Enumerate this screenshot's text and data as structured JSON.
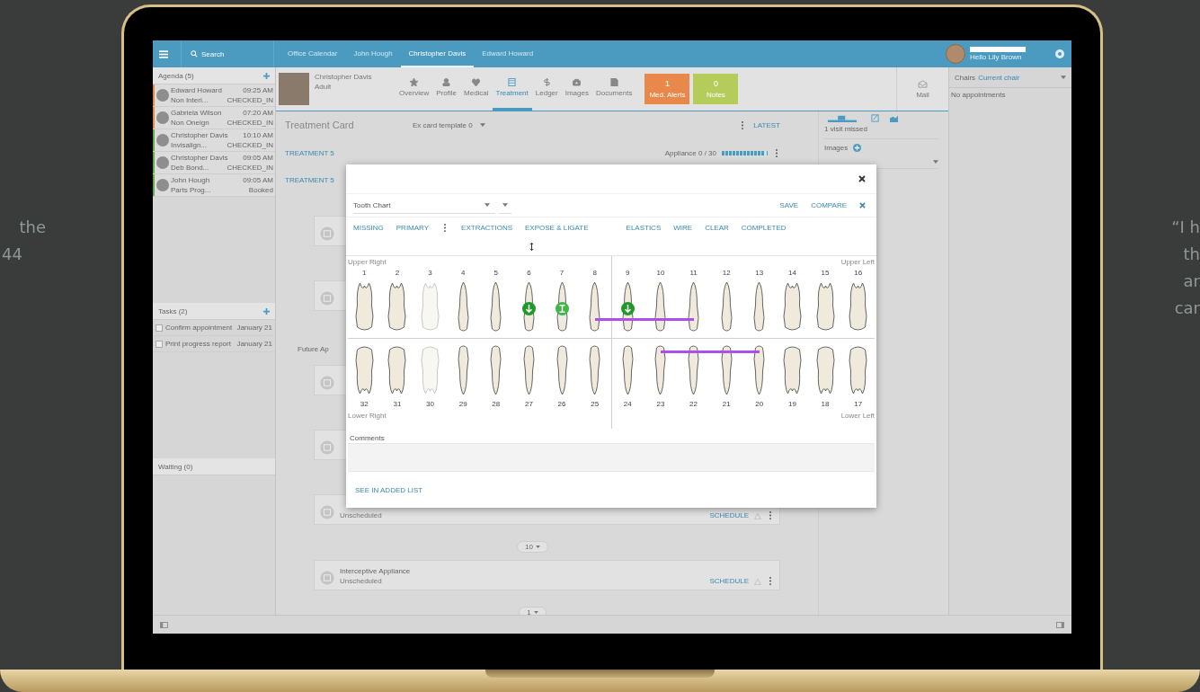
{
  "backdrop": {
    "left_text": [
      "the",
      "44"
    ],
    "right_text": [
      "“I h",
      "th",
      "ar",
      "car"
    ]
  },
  "topbar": {
    "search": "Search",
    "tabs": [
      {
        "label": "Office Calendar",
        "selected": false
      },
      {
        "label": "John Hough",
        "selected": false
      },
      {
        "label": "Christopher Davis",
        "selected": true
      },
      {
        "label": "Edward Howard",
        "selected": false
      }
    ],
    "user": "Hello Lily Brown"
  },
  "sidebar": {
    "agenda": {
      "title": "Agenda (5)",
      "rows": [
        {
          "name": "Edward Howard",
          "time": "09:25 AM",
          "detail": "Non Interi...",
          "status": "CHECKED_IN",
          "color": "#e8884a"
        },
        {
          "name": "Gabriela Wilson",
          "time": "07:20 AM",
          "detail": "Non Oneign",
          "status": "CHECKED_IN",
          "color": "#e8884a"
        },
        {
          "name": "Christopher Davis",
          "time": "10:10 AM",
          "detail": "Invisalign...",
          "status": "CHECKED_IN",
          "color": "#6aa84f"
        },
        {
          "name": "Christopher Davis",
          "time": "09:05 AM",
          "detail": "Deb Bond...",
          "status": "CHECKED_IN",
          "color": "#6aa84f"
        },
        {
          "name": "John Hough",
          "time": "09:05 AM",
          "detail": "Parts Prog...",
          "status": "Booked",
          "color": "#6aa84f"
        }
      ]
    },
    "tasks": {
      "title": "Tasks (2)",
      "items": [
        {
          "text": "Confirm appointment",
          "date": "January 21",
          "checked": false
        },
        {
          "text": "Print progress report",
          "date": "January 21",
          "checked": false
        }
      ]
    },
    "waiting": {
      "title": "Waiting (0)"
    }
  },
  "patient": {
    "name": "Christopher Davis",
    "subtitle": "Adult",
    "tabs": [
      {
        "label": "Overview",
        "selected": false
      },
      {
        "label": "Profile",
        "selected": false
      },
      {
        "label": "Medical",
        "selected": false
      },
      {
        "label": "Treatment",
        "selected": true
      },
      {
        "label": "Ledger",
        "selected": false
      },
      {
        "label": "Images",
        "selected": false
      },
      {
        "label": "Documents",
        "selected": false
      }
    ],
    "tiles": [
      {
        "value": "1",
        "label": "Med. Alerts",
        "color": "#e8884a"
      },
      {
        "value": "0",
        "label": "Notes",
        "color": "#b5cc5a"
      }
    ],
    "mail": "Mail"
  },
  "treatment": {
    "title": "Treatment Card",
    "template": "Ex card template 0",
    "latest": "LATEST",
    "section": "TREATMENT 5",
    "appliance": {
      "label": "Appliance 0 / 30",
      "level": 0.95
    },
    "items": [
      {
        "kind": "heading",
        "text": "TREATMENT 5"
      },
      {
        "kind": "card"
      },
      {
        "kind": "card"
      },
      {
        "kind": "label",
        "text": "Future Ap"
      },
      {
        "kind": "card"
      },
      {
        "kind": "card"
      },
      {
        "kind": "card",
        "status": "Unscheduled",
        "action": "SCHEDULE"
      },
      {
        "kind": "pill",
        "text": "10"
      },
      {
        "kind": "card",
        "title": "Interceptive Appliance",
        "status": "Unscheduled",
        "action": "SCHEDULE"
      },
      {
        "kind": "pill",
        "text": "1"
      }
    ]
  },
  "side": {
    "visits": "1 visit missed",
    "images": "Images"
  },
  "chairs": {
    "title": "Chairs",
    "value": "Current chair",
    "empty": "No appointments"
  },
  "chart": {
    "title": "Tooth Chart",
    "save": "SAVE",
    "compare": "COMPARE",
    "actions": [
      "MISSING",
      "PRIMARY",
      "EXTRACTIONS",
      "EXPOSE & LIGATE",
      "ELASTICS",
      "WIRE",
      "CLEAR",
      "COMPLETED"
    ],
    "quadrants": {
      "upper_right": "Upper Right",
      "upper_left": "Upper Left",
      "lower_right": "Lower Right",
      "lower_left": "Lower Left"
    },
    "upper": [
      {
        "number": "1",
        "kind": "molar",
        "missing": false,
        "elastic": false
      },
      {
        "number": "2",
        "kind": "molar",
        "missing": false,
        "elastic": false
      },
      {
        "number": "3",
        "kind": "molar",
        "missing": true,
        "elastic": false
      },
      {
        "number": "4",
        "kind": "single",
        "missing": false,
        "elastic": false
      },
      {
        "number": "5",
        "kind": "single",
        "missing": false,
        "elastic": false
      },
      {
        "number": "6",
        "kind": "single",
        "missing": false,
        "elastic": false,
        "marker": {
          "kind": "extraction"
        }
      },
      {
        "number": "7",
        "kind": "single",
        "missing": false,
        "elastic": false,
        "marker": {
          "kind": "expose"
        }
      },
      {
        "number": "8",
        "kind": "single",
        "missing": false,
        "elastic": true
      },
      {
        "number": "9",
        "kind": "single",
        "missing": false,
        "elastic": true,
        "marker": {
          "kind": "extraction"
        }
      },
      {
        "number": "10",
        "kind": "single",
        "missing": false,
        "elastic": true
      },
      {
        "number": "11",
        "kind": "single",
        "missing": false,
        "elastic": true
      },
      {
        "number": "12",
        "kind": "single",
        "missing": false,
        "elastic": false
      },
      {
        "number": "13",
        "kind": "single",
        "missing": false,
        "elastic": false
      },
      {
        "number": "14",
        "kind": "molar",
        "missing": false,
        "elastic": false
      },
      {
        "number": "15",
        "kind": "molar",
        "missing": false,
        "elastic": false
      },
      {
        "number": "16",
        "kind": "molar",
        "missing": false,
        "elastic": false
      }
    ],
    "lower": [
      {
        "number": "32",
        "kind": "molar",
        "missing": false,
        "elastic": false
      },
      {
        "number": "31",
        "kind": "molar",
        "missing": false,
        "elastic": false
      },
      {
        "number": "30",
        "kind": "molar",
        "missing": true,
        "elastic": false
      },
      {
        "number": "29",
        "kind": "single",
        "missing": false,
        "elastic": false
      },
      {
        "number": "28",
        "kind": "single",
        "missing": false,
        "elastic": false
      },
      {
        "number": "27",
        "kind": "single",
        "missing": false,
        "elastic": false
      },
      {
        "number": "26",
        "kind": "single",
        "missing": false,
        "elastic": false
      },
      {
        "number": "25",
        "kind": "single",
        "missing": false,
        "elastic": false
      },
      {
        "number": "24",
        "kind": "single",
        "missing": false,
        "elastic": false
      },
      {
        "number": "23",
        "kind": "single",
        "missing": false,
        "elastic": true
      },
      {
        "number": "22",
        "kind": "single",
        "missing": false,
        "elastic": true
      },
      {
        "number": "21",
        "kind": "single",
        "missing": false,
        "elastic": true
      },
      {
        "number": "20",
        "kind": "single",
        "missing": false,
        "elastic": true
      },
      {
        "number": "19",
        "kind": "molar",
        "missing": false,
        "elastic": false
      },
      {
        "number": "18",
        "kind": "molar",
        "missing": false,
        "elastic": false
      },
      {
        "number": "17",
        "kind": "molar",
        "missing": false,
        "elastic": false
      }
    ],
    "comments_label": "Comments",
    "footer_link": "SEE IN ADDED LIST"
  }
}
